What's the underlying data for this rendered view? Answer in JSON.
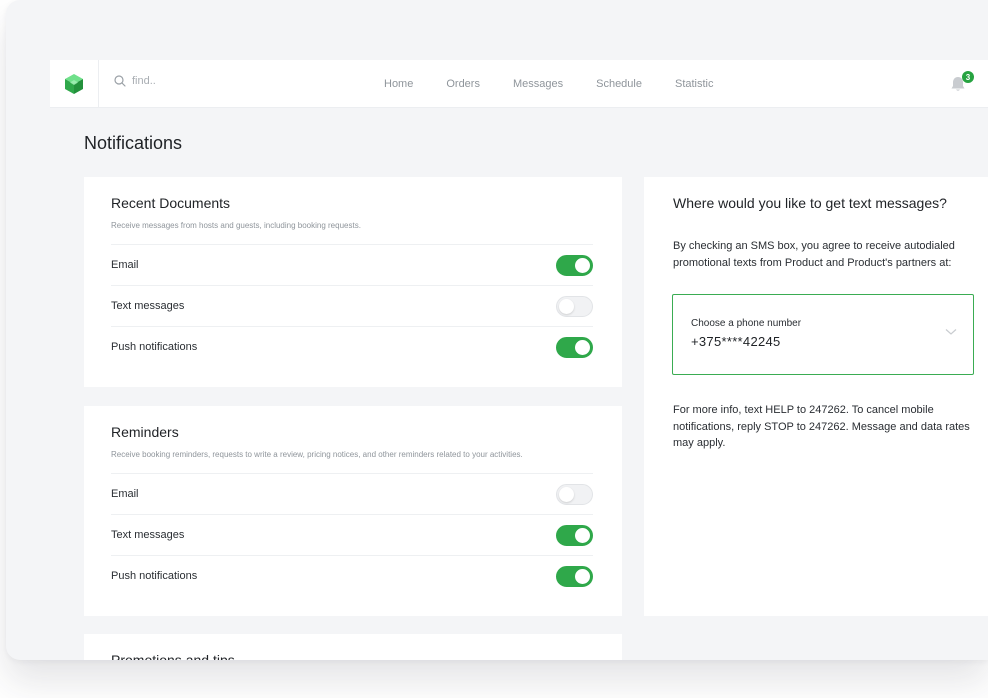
{
  "header": {
    "search": {
      "placeholder": "find.."
    },
    "nav": [
      {
        "label": "Home"
      },
      {
        "label": "Orders"
      },
      {
        "label": "Messages"
      },
      {
        "label": "Schedule"
      },
      {
        "label": "Statistic"
      }
    ],
    "notifications_count": "3"
  },
  "page": {
    "title": "Notifications"
  },
  "sections": [
    {
      "title": "Recent Documents",
      "description": "Receive messages from hosts and guests, including booking requests.",
      "rows": [
        {
          "label": "Email",
          "enabled": true
        },
        {
          "label": "Text messages",
          "enabled": false
        },
        {
          "label": "Push notifications",
          "enabled": true
        }
      ]
    },
    {
      "title": "Reminders",
      "description": "Receive booking reminders, requests to write a review, pricing notices, and other reminders related to your activities.",
      "rows": [
        {
          "label": "Email",
          "enabled": false
        },
        {
          "label": "Text messages",
          "enabled": true
        },
        {
          "label": "Push notifications",
          "enabled": true
        }
      ]
    },
    {
      "title": "Promotions and tips"
    }
  ],
  "sms": {
    "title": "Where would you like to get text messages?",
    "consent_text": "By checking an SMS box, you agree to receive autodialed promotional texts from Product and Product's partners at:",
    "phone_label": "Choose a phone number",
    "phone_value": "+375****42245",
    "info_text": "For more info, text HELP to 247262. To cancel mobile notifications, reply STOP to 247262. Message and data rates may apply."
  },
  "colors": {
    "accent": "#2fa84a",
    "background": "#f4f5f7"
  }
}
